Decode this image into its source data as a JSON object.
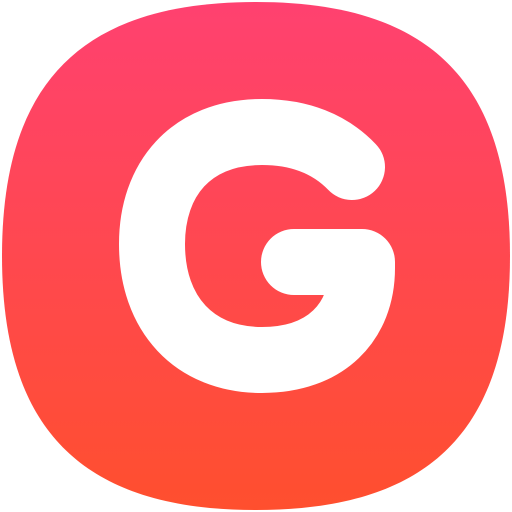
{
  "icon": {
    "name": "g-logo-icon",
    "letter": "G",
    "colors": {
      "gradient_top": "#FF4170",
      "gradient_bottom": "#FF4F2E",
      "glyph": "#FFFFFF"
    }
  }
}
